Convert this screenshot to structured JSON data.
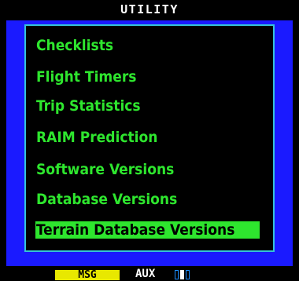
{
  "header": {
    "title": "UTILITY"
  },
  "menu": {
    "items": [
      {
        "label": "Checklists"
      },
      {
        "label": "Flight Timers"
      },
      {
        "label": "Trip Statistics"
      },
      {
        "label": "RAIM Prediction"
      },
      {
        "label": "Software Versions"
      },
      {
        "label": "Database Versions"
      },
      {
        "label": "Terrain Database Versions"
      }
    ],
    "selected_index": 6
  },
  "status_bar": {
    "msg_label": "MSG",
    "aux_label": "AUX",
    "page_count": 3,
    "active_page": 2
  },
  "colors": {
    "screen_bg": "#1a1aff",
    "menu_text": "#2ee62e",
    "menu_border": "#35c4d8",
    "msg_bg": "#e8e800"
  }
}
